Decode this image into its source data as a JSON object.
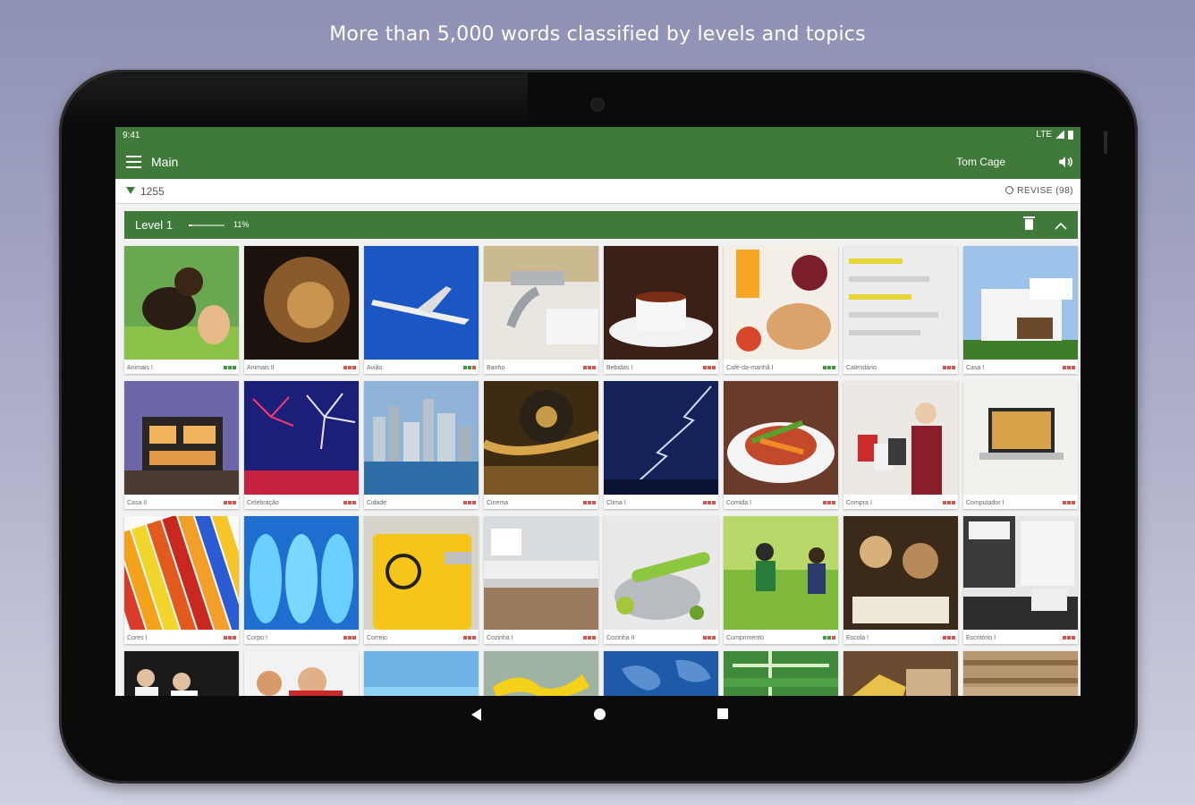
{
  "headline": "More than 5,000 words classified by levels and topics",
  "status_bar": {
    "time": "9:41",
    "network": "LTE"
  },
  "app_bar": {
    "title": "Main",
    "user": "Tom Cage"
  },
  "sub_bar": {
    "points": "1255",
    "revise": "REVISE (98)"
  },
  "level": {
    "title": "Level 1",
    "progress_text": "11%",
    "progress": 0.11
  },
  "colors": {
    "brand_green": "#3f7a3a"
  },
  "tiles": [
    {
      "caption": "Animais I",
      "dots": "ggg"
    },
    {
      "caption": "Animais II",
      "dots": "rrr"
    },
    {
      "caption": "Avião",
      "dots": "ggr"
    },
    {
      "caption": "Banho",
      "dots": "rrr"
    },
    {
      "caption": "Bebidas I",
      "dots": "rrr"
    },
    {
      "caption": "Café-da-manhã I",
      "dots": "ggg"
    },
    {
      "caption": "Calendário",
      "dots": "rrr"
    },
    {
      "caption": "Casa I",
      "dots": "rrr"
    },
    {
      "caption": "Casa II",
      "dots": "rrr"
    },
    {
      "caption": "Celebração",
      "dots": "rrr"
    },
    {
      "caption": "Cidade",
      "dots": "rrr"
    },
    {
      "caption": "Cinema",
      "dots": "rrr"
    },
    {
      "caption": "Clima I",
      "dots": "rrr"
    },
    {
      "caption": "Comida I",
      "dots": "rrr"
    },
    {
      "caption": "Compra I",
      "dots": "rrr"
    },
    {
      "caption": "Computador I",
      "dots": "rrr"
    },
    {
      "caption": "Cores I",
      "dots": "rrr"
    },
    {
      "caption": "Corpo I",
      "dots": "rrr"
    },
    {
      "caption": "Correio",
      "dots": "rrr"
    },
    {
      "caption": "Cozinha I",
      "dots": "rrr"
    },
    {
      "caption": "Cozinha II",
      "dots": "rrr"
    },
    {
      "caption": "Cumprimento",
      "dots": "ggr"
    },
    {
      "caption": "Escola I",
      "dots": "rrr"
    },
    {
      "caption": "Escritório I",
      "dots": "rrr"
    },
    {
      "caption": "",
      "dots": ""
    },
    {
      "caption": "",
      "dots": ""
    },
    {
      "caption": "",
      "dots": ""
    },
    {
      "caption": "",
      "dots": ""
    },
    {
      "caption": "",
      "dots": ""
    },
    {
      "caption": "",
      "dots": ""
    },
    {
      "caption": "",
      "dots": ""
    },
    {
      "caption": "",
      "dots": ""
    }
  ]
}
